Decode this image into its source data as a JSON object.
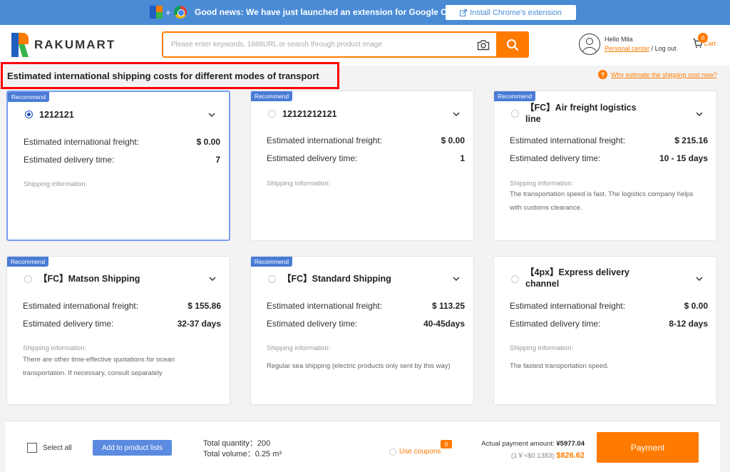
{
  "topbar": {
    "plus": "+",
    "announcement": "Good news: We have just launched an extension for Google Chrome",
    "install_button": "Install Chrome's extension"
  },
  "header": {
    "logo_text": "RAKUMART",
    "search_placeholder": "Please enter keywords, 1688URL or search through product image",
    "greeting": "Hello Mila",
    "personal_center": "Personal center",
    "separator": " / ",
    "logout": "Log out",
    "cart_count": "0",
    "cart_label": "Cart"
  },
  "section": {
    "title": "Estimated international shipping costs for different modes of transport",
    "why_link": "Why estimate the shipping cost now?",
    "why_icon": "?"
  },
  "labels": {
    "recommend": "Recommend",
    "freight": "Estimated international freight:",
    "delivery": "Estimated delivery time:",
    "shipping_info": "Shipping information:"
  },
  "cards": [
    {
      "name": "1212121",
      "freight": "$ 0.00",
      "delivery": "7",
      "info": "",
      "recommend": true,
      "selected": true
    },
    {
      "name": "12121212121",
      "freight": "$ 0.00",
      "delivery": "1",
      "info": "",
      "recommend": true,
      "selected": false
    },
    {
      "name": "【FC】Air freight logistics line",
      "freight": "$ 215.16",
      "delivery": "10 - 15 days",
      "info": "The transportation speed is fast. The logistics company helps with customs clearance.",
      "recommend": true,
      "selected": false
    },
    {
      "name": "【FC】Matson Shipping",
      "freight": "$ 155.86",
      "delivery": "32-37 days",
      "info": "There are other time-effective quotations for ocean transportation. If necessary, consult separately",
      "recommend": true,
      "selected": false
    },
    {
      "name": "【FC】Standard Shipping",
      "freight": "$ 113.25",
      "delivery": "40-45days",
      "info": "Regular sea shipping (electric products only sent by this way)",
      "recommend": true,
      "selected": false
    },
    {
      "name": "【4px】Express delivery channel",
      "freight": "$ 0.00",
      "delivery": "8-12 days",
      "info": "The fastest transportation speed.",
      "recommend": false,
      "selected": false
    }
  ],
  "bottom": {
    "select_all": "Select all",
    "add_to_lists": "Add to product lists",
    "total_quantity_label": "Total quantity：",
    "total_quantity": "200",
    "total_volume_label": "Total volume：",
    "total_volume": "0.25 m³",
    "use_coupons": "Use coupons",
    "coupon_count": "0",
    "actual_label": "Actual payment amount:",
    "actual_amount": "¥5977.04",
    "rate": "(1￥≈$0.1383)",
    "usd_amount": "$826.62",
    "payment": "Payment"
  },
  "colors": {
    "brand_orange": "#ff7b00",
    "banner_blue": "#4a8bd6",
    "recommend_blue": "#4a7bd6",
    "highlight_red": "#ff0000"
  }
}
